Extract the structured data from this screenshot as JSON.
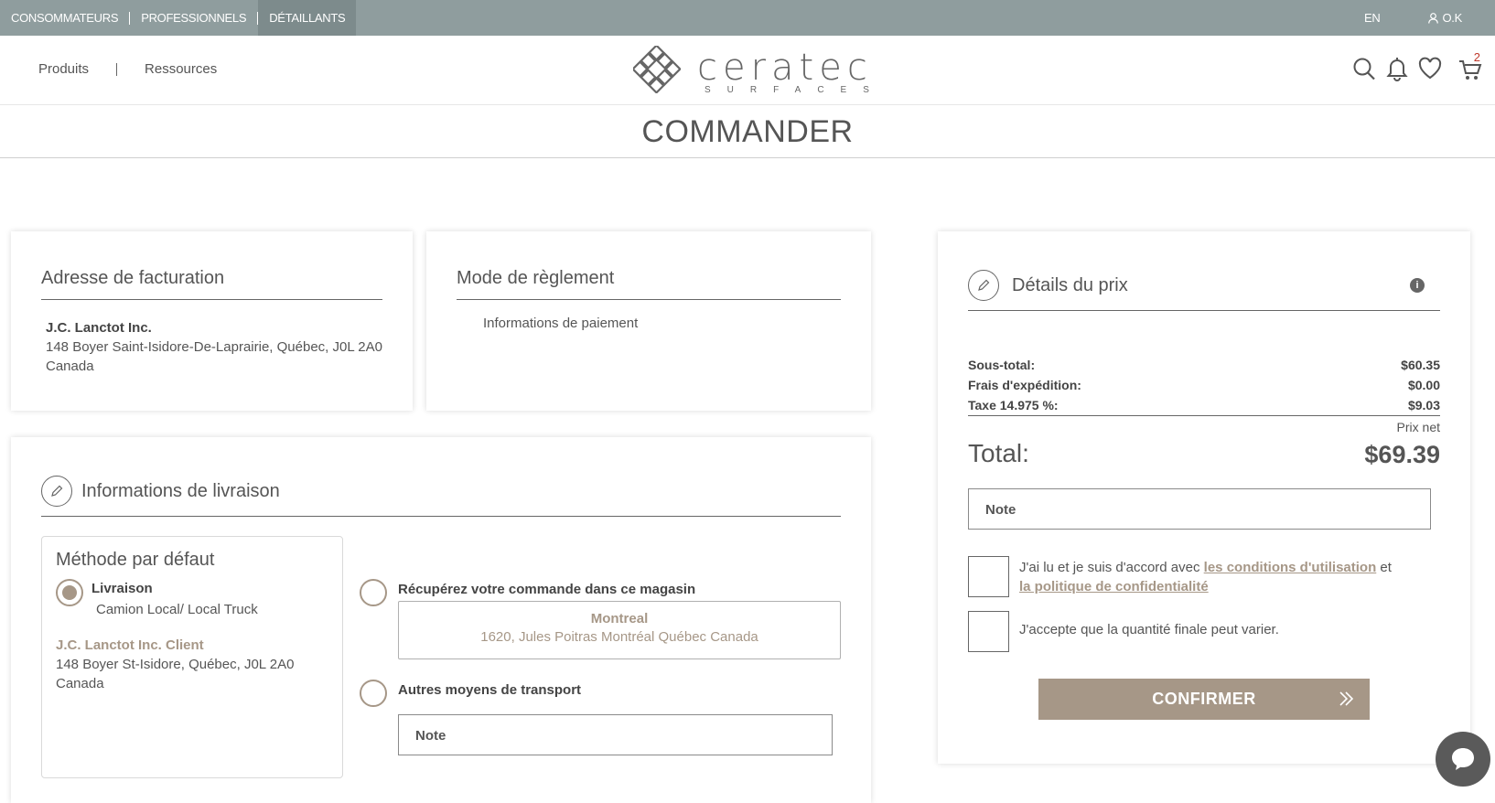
{
  "topbar": {
    "tabs": [
      {
        "label": "CONSOMMATEURS"
      },
      {
        "label": "PROFESSIONNELS"
      },
      {
        "label": "DÉTAILLANTS"
      }
    ],
    "lang": "EN",
    "user": "O.K"
  },
  "header": {
    "nav": [
      {
        "label": "Produits"
      },
      {
        "label": "Ressources"
      }
    ],
    "logo_word": "ceratec",
    "logo_sub": "SURFACES",
    "cart_count": "2"
  },
  "page_title": "COMMANDER",
  "billing": {
    "title": "Adresse de facturation",
    "name": "J.C. Lanctot Inc.",
    "line1": "148 Boyer Saint-Isidore-De-Laprairie, Québec, J0L 2A0",
    "line2": "Canada"
  },
  "payment": {
    "title": "Mode de règlement",
    "info": "Informations de paiement"
  },
  "shipping": {
    "title": "Informations de livraison",
    "method_title": "Méthode par défaut",
    "delivery_label": "Livraison",
    "carrier": "Camion Local/ Local Truck",
    "client_name": "J.C. Lanctot Inc. Client",
    "client_line1": "148 Boyer St-Isidore, Québec, J0L 2A0",
    "client_line2": "Canada",
    "pickup_label": "Récupérez votre commande dans ce magasin",
    "store_name": "Montreal",
    "store_address": "1620, Jules Poitras Montréal Québec Canada",
    "other_label": "Autres moyens de transport",
    "note_placeholder": "Note"
  },
  "price": {
    "title": "Détails du prix",
    "rows": [
      {
        "label": "Sous-total:",
        "value": "$60.35"
      },
      {
        "label": "Frais d'expédition:",
        "value": "$0.00"
      },
      {
        "label": "Taxe 14.975 %:",
        "value": "$9.03"
      }
    ],
    "prix_net": "Prix net",
    "total_label": "Total:",
    "total_value": "$69.39",
    "note_placeholder": "Note",
    "terms_prefix": "J'ai lu et je suis d'accord avec ",
    "terms_link1": "les conditions d'utilisation",
    "terms_mid": " et",
    "terms_link2": "la politique de confidentialité",
    "qty_text": "J'accepte que la quantité finale peut varier.",
    "confirm_label": "CONFIRMER"
  },
  "colors": {
    "topbar": "#8f9d9e",
    "accent": "#a69787"
  }
}
